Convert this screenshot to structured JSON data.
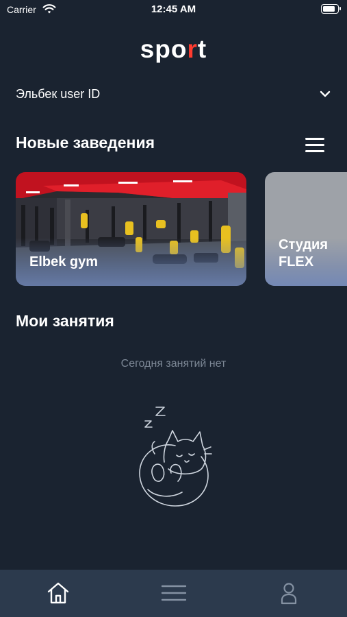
{
  "status_bar": {
    "carrier": "Carrier",
    "time": "12:45 AM",
    "battery_level": 0.9
  },
  "header": {
    "logo_main": "spo",
    "logo_accent": "r",
    "logo_end": "t"
  },
  "user_select": {
    "name": "Эльбек user ID"
  },
  "sections": {
    "new_places_title": "Новые заведения",
    "my_classes_title": "Мои занятия"
  },
  "places": [
    {
      "name": "Elbek gym"
    },
    {
      "name": "Студия\nFLEX"
    }
  ],
  "empty_state": {
    "text": "Сегодня занятий нет"
  },
  "colors": {
    "background": "#1a2330",
    "tabbar": "#2c3a4d",
    "accent": "#ff3b2f",
    "muted_text": "#7d8896"
  },
  "icons": {
    "wifi": "wifi-icon",
    "battery": "battery-icon",
    "chevron": "chevron-down-icon",
    "menu": "hamburger-menu-icon",
    "home": "home-icon",
    "list": "list-icon",
    "profile": "profile-icon",
    "illustration": "sleeping-cat-illustration"
  }
}
